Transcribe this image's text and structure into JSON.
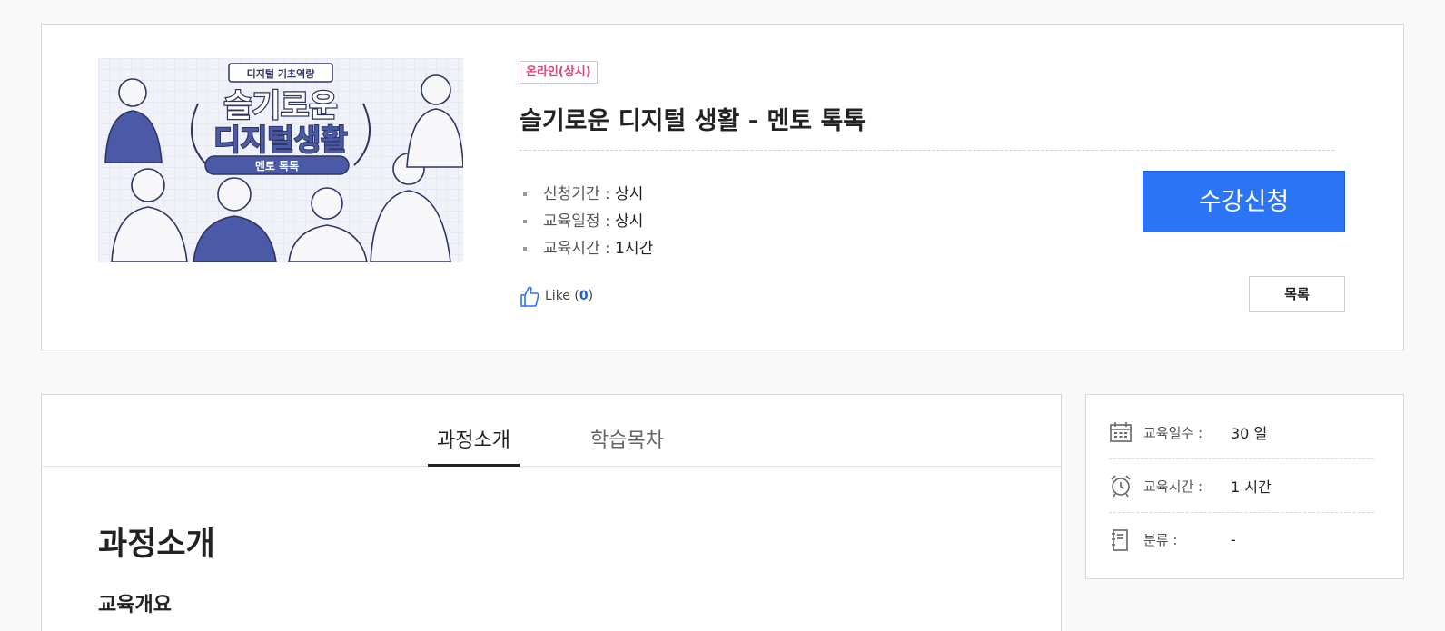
{
  "course": {
    "badge": "온라인(상시)",
    "title": "슬기로운 디지털 생활 - 멘토 톡톡",
    "thumbnail": {
      "top_label": "디지털 기초역량",
      "line1": "슬기로운",
      "line2": "디지털생활",
      "ribbon": "멘토 톡톡"
    },
    "info": [
      {
        "label": "신청기간 : ",
        "value": "상시"
      },
      {
        "label": "교육일정 : ",
        "value": "상시"
      },
      {
        "label": "교육시간 : ",
        "value": "1시간"
      }
    ],
    "like_label": "Like (",
    "like_count": "0",
    "like_close": ")",
    "apply_button": "수강신청",
    "list_button": "목록"
  },
  "tabs": [
    {
      "label": "과정소개",
      "active": true
    },
    {
      "label": "학습목차",
      "active": false
    }
  ],
  "content": {
    "section_title": "과정소개",
    "subsection_title": "교육개요"
  },
  "side": [
    {
      "icon": "calendar-icon",
      "label": "교육일수 : ",
      "value": "30 일"
    },
    {
      "icon": "alarm-clock-icon",
      "label": "교육시간 : ",
      "value": "1 시간"
    },
    {
      "icon": "notebook-icon",
      "label": "분류 : ",
      "value": "-"
    }
  ],
  "colors": {
    "accent": "#2a74f5",
    "badge": "#e0457a",
    "illustration": "#4a5aa8"
  }
}
